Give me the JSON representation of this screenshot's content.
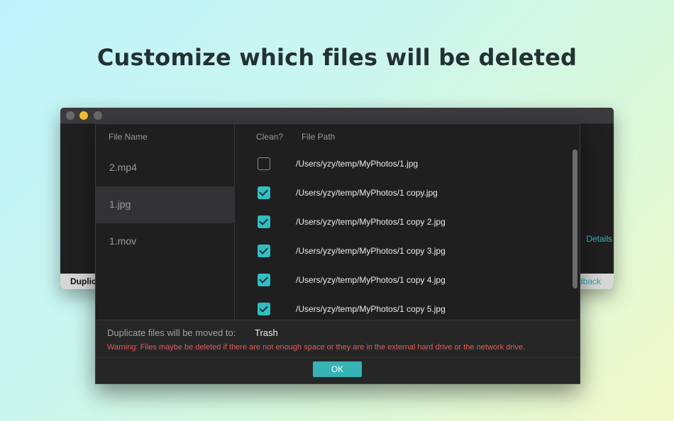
{
  "headline": "Customize which files will be deleted",
  "background_window": {
    "status_text": "Duplic",
    "details_link": "Details",
    "feedback_link": "dback"
  },
  "dialog": {
    "left_column_header": "File Name",
    "files": [
      {
        "name": "2.mp4",
        "selected": false
      },
      {
        "name": "1.jpg",
        "selected": true
      },
      {
        "name": "1.mov",
        "selected": false
      }
    ],
    "clean_header": "Clean?",
    "path_header": "File Path",
    "rows": [
      {
        "checked": false,
        "path": "/Users/yzy/temp/MyPhotos/1.jpg"
      },
      {
        "checked": true,
        "path": "/Users/yzy/temp/MyPhotos/1 copy.jpg"
      },
      {
        "checked": true,
        "path": "/Users/yzy/temp/MyPhotos/1 copy 2.jpg"
      },
      {
        "checked": true,
        "path": "/Users/yzy/temp/MyPhotos/1 copy 3.jpg"
      },
      {
        "checked": true,
        "path": "/Users/yzy/temp/MyPhotos/1 copy 4.jpg"
      },
      {
        "checked": true,
        "path": "/Users/yzy/temp/MyPhotos/1 copy 5.jpg"
      }
    ],
    "moved_label": "Duplicate files will be moved to:",
    "moved_value": "Trash",
    "warning": "Warning: Files maybe be deleted if there are not enough space or they are in the external hard drive or the network drive.",
    "ok_label": "OK"
  },
  "colors": {
    "accent": "#33bdc3",
    "warning": "#e05d57",
    "window_bg": "#1f1f20"
  }
}
